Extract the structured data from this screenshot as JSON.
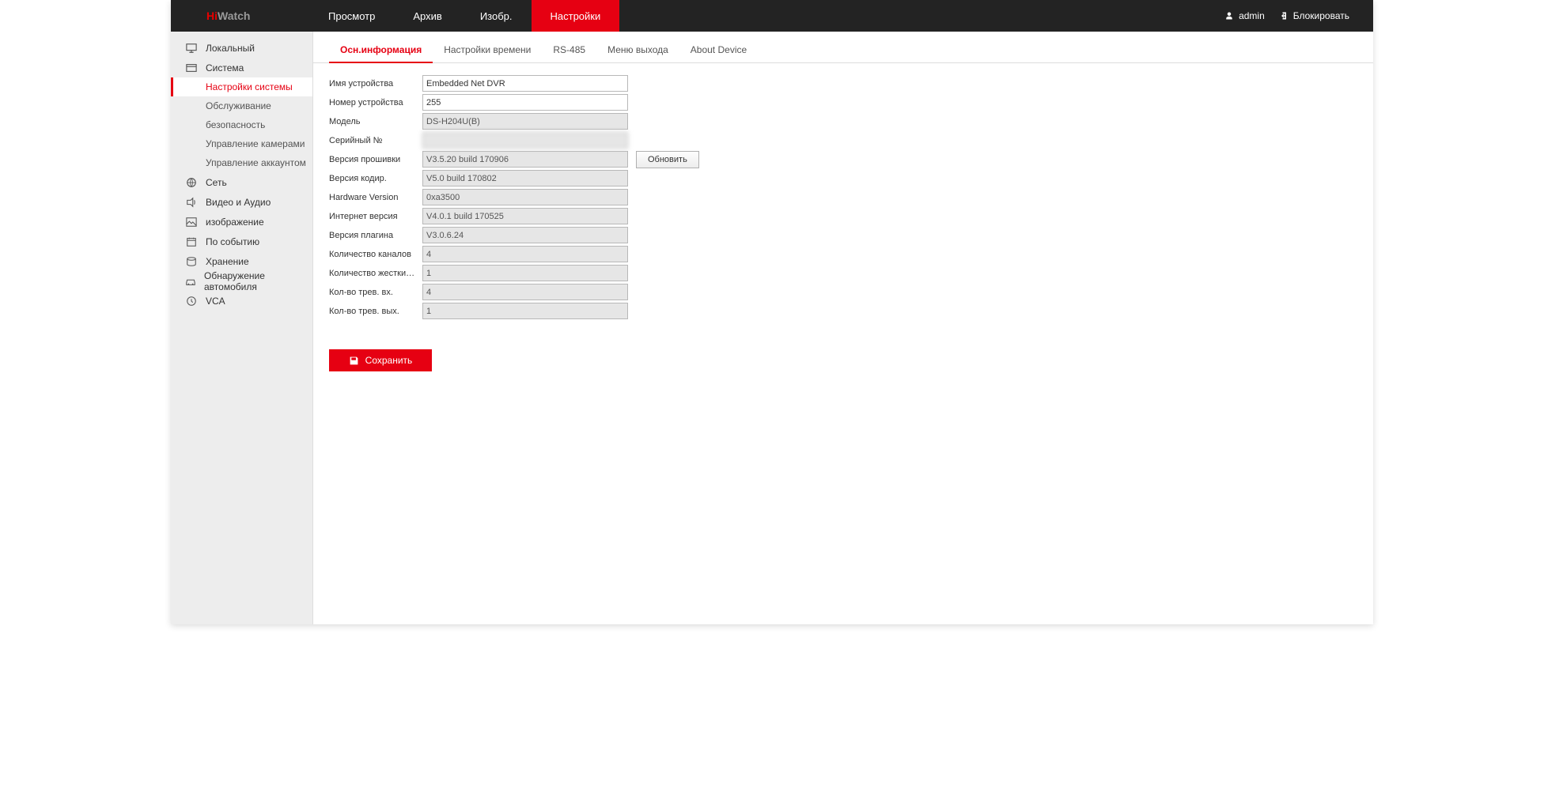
{
  "brand": {
    "hi": "Hi",
    "watch": "Watch"
  },
  "topnav": [
    {
      "label": "Просмотр",
      "active": false
    },
    {
      "label": "Архив",
      "active": false
    },
    {
      "label": "Изобр.",
      "active": false
    },
    {
      "label": "Настройки",
      "active": true
    }
  ],
  "user": {
    "name": "admin",
    "lock_label": "Блокировать"
  },
  "sidebar": [
    {
      "icon": "monitor",
      "label": "Локальный",
      "sub": []
    },
    {
      "icon": "system",
      "label": "Система",
      "active": true,
      "sub": [
        {
          "label": "Настройки системы",
          "active": true
        },
        {
          "label": "Обслуживание"
        },
        {
          "label": "безопасность"
        },
        {
          "label": "Управление камерами"
        },
        {
          "label": "Управление аккаунтом"
        }
      ]
    },
    {
      "icon": "globe",
      "label": "Сеть",
      "sub": []
    },
    {
      "icon": "av",
      "label": "Видео и Аудио",
      "sub": []
    },
    {
      "icon": "image",
      "label": "изображение",
      "sub": []
    },
    {
      "icon": "calendar",
      "label": "По событию",
      "sub": []
    },
    {
      "icon": "storage",
      "label": "Хранение",
      "sub": []
    },
    {
      "icon": "car",
      "label": "Обнаружение автомобиля",
      "sub": []
    },
    {
      "icon": "vca",
      "label": "VCA",
      "sub": []
    }
  ],
  "tabs": [
    {
      "label": "Осн.информация",
      "active": true
    },
    {
      "label": "Настройки времени"
    },
    {
      "label": "RS-485"
    },
    {
      "label": "Меню выхода"
    },
    {
      "label": "About Device"
    }
  ],
  "form": {
    "device_name": {
      "label": "Имя устройства",
      "value": "Embedded Net DVR",
      "editable": true
    },
    "device_no": {
      "label": "Номер устройства",
      "value": "255",
      "editable": true
    },
    "model": {
      "label": "Модель",
      "value": "DS-H204U(B)"
    },
    "serial": {
      "label": "Серийный №",
      "value": ""
    },
    "fw_version": {
      "label": "Версия прошивки",
      "value": "V3.5.20 build 170906",
      "button": "Обновить"
    },
    "enc_version": {
      "label": "Версия кодир.",
      "value": "V5.0 build 170802"
    },
    "hw_version": {
      "label": "Hardware Version",
      "value": "0xa3500"
    },
    "web_version": {
      "label": "Интернет версия",
      "value": "V4.0.1 build 170525"
    },
    "plugin_version": {
      "label": "Версия плагина",
      "value": "V3.0.6.24"
    },
    "channels": {
      "label": "Количество каналов",
      "value": "4"
    },
    "hdds": {
      "label": "Количество жестких дис...",
      "value": "1"
    },
    "alarm_in": {
      "label": "Кол-во трев. вх.",
      "value": "4"
    },
    "alarm_out": {
      "label": "Кол-во трев. вых.",
      "value": "1"
    }
  },
  "save_label": "Сохранить"
}
